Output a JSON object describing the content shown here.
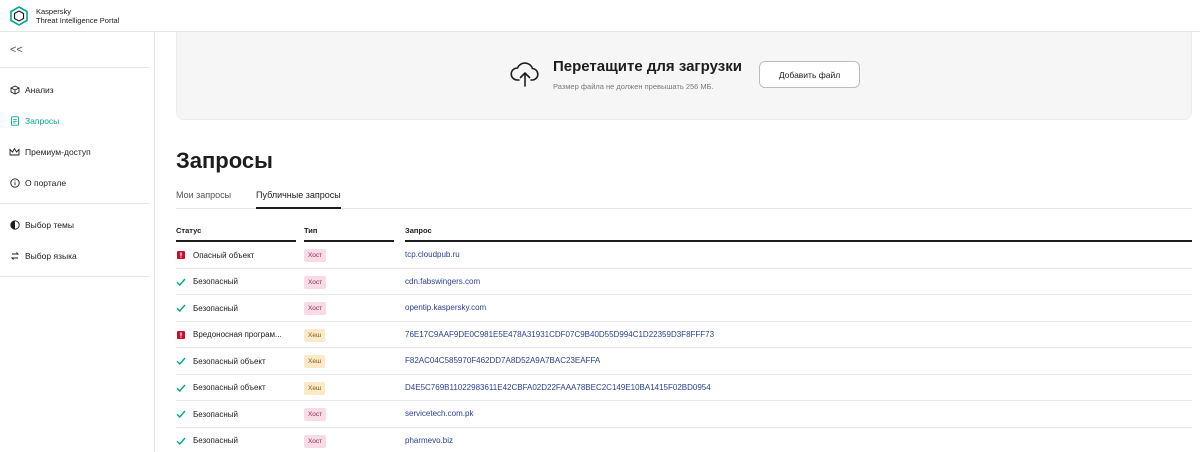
{
  "brand": {
    "line1": "Kaspersky",
    "line2": "Threat Intelligence Portal"
  },
  "sidebar": {
    "collapse_label": "<<",
    "items": [
      {
        "label": "Анализ",
        "icon": "cube-icon",
        "active": false
      },
      {
        "label": "Запросы",
        "icon": "document-icon",
        "active": true
      },
      {
        "label": "Премиум-доступ",
        "icon": "crown-icon",
        "active": false
      },
      {
        "label": "О портале",
        "icon": "info-icon",
        "active": false
      },
      {
        "label": "Выбор темы",
        "icon": "theme-icon",
        "active": false
      },
      {
        "label": "Выбор языка",
        "icon": "language-icon",
        "active": false
      }
    ]
  },
  "upload": {
    "title": "Перетащите для загрузки",
    "subtitle": "Размер файла не должен превышать 256 МБ.",
    "button": "Добавить файл"
  },
  "page": {
    "title": "Запросы",
    "tabs": [
      {
        "label": "Мои запросы",
        "active": false
      },
      {
        "label": "Публичные запросы",
        "active": true
      }
    ]
  },
  "table": {
    "columns": [
      "Статус",
      "Тип",
      "Запрос"
    ],
    "rows": [
      {
        "status": "Опасный объект",
        "danger": true,
        "type": "Хост",
        "kind": "host",
        "query": "tcp.cloudpub.ru"
      },
      {
        "status": "Безопасный",
        "danger": false,
        "type": "Хост",
        "kind": "host",
        "query": "cdn.fabswingers.com"
      },
      {
        "status": "Безопасный",
        "danger": false,
        "type": "Хост",
        "kind": "host",
        "query": "opentip.kaspersky.com"
      },
      {
        "status": "Вредоносная програм...",
        "danger": true,
        "type": "Хеш",
        "kind": "hash",
        "query": "76E17C9AAF9DE0C981E5E478A31931CDF07C9B40D55D994C1D22359D3F8FFF73"
      },
      {
        "status": "Безопасный объект",
        "danger": false,
        "type": "Хеш",
        "kind": "hash",
        "query": "F82AC04C585970F462DD7A8D52A9A7BAC23EAFFA"
      },
      {
        "status": "Безопасный объект",
        "danger": false,
        "type": "Хеш",
        "kind": "hash",
        "query": "D4E5C769B11022983611E42CBFA02D22FAAA78BEC2C149E10BA1415F02BD0954"
      },
      {
        "status": "Безопасный",
        "danger": false,
        "type": "Хост",
        "kind": "host",
        "query": "servicetech.com.pk"
      },
      {
        "status": "Безопасный",
        "danger": false,
        "type": "Хост",
        "kind": "host",
        "query": "pharmevo.biz"
      }
    ]
  },
  "colors": {
    "accent": "#00a88e",
    "danger": "#c8102e",
    "link": "#2b3f93",
    "host_badge": "#f9dbe7",
    "hash_badge": "#fbe9c8"
  }
}
